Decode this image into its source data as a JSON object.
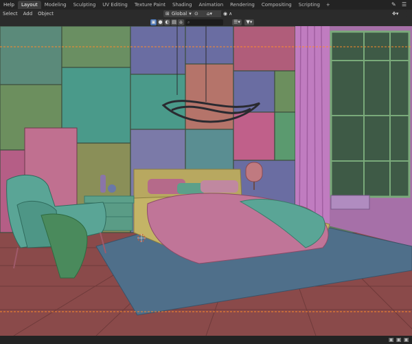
{
  "topbar": {
    "menu_help": "Help",
    "tabs": [
      "Layout",
      "Modeling",
      "Sculpting",
      "UV Editing",
      "Texture Paint",
      "Shading",
      "Animation",
      "Rendering",
      "Compositing",
      "Scripting"
    ],
    "add_tab": "+"
  },
  "header": {
    "select": "Select",
    "add": "Add",
    "object": "Object",
    "orientation": "Global"
  },
  "colors": {
    "accent": "#4772b3",
    "selection_outline": "#ff8a2a"
  }
}
